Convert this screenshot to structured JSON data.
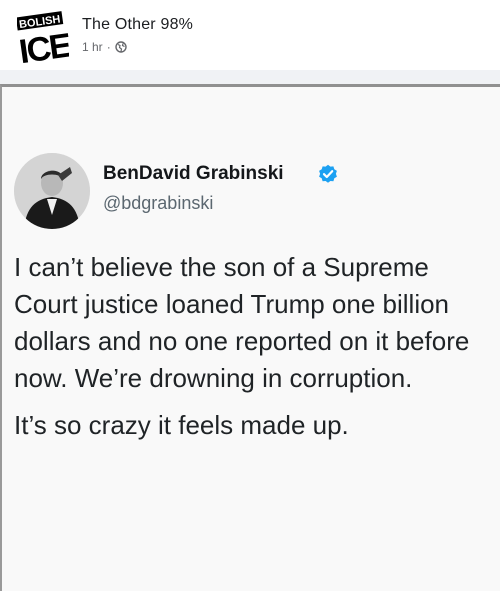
{
  "post": {
    "page_name": "The Other 98%",
    "time": "1 hr",
    "separator": "·",
    "avatar_text_top": "BOLISH",
    "avatar_text_main": "ICE"
  },
  "tweet": {
    "display_name": "BenDavid Grabinski",
    "handle": "@bdgrabinski",
    "paragraph1": "I can’t believe the son of a Supreme Court justice loaned Trump one billion dollars and no one reported on it before now. We’re drowning in corruption.",
    "paragraph2": "It’s so crazy it feels made up."
  },
  "colors": {
    "verified_blue": "#1da1f2",
    "meta_gray": "#65676b",
    "divider_gray": "#f0f2f5"
  },
  "icons": {
    "globe": "globe-icon",
    "verified": "verified-badge-icon"
  }
}
